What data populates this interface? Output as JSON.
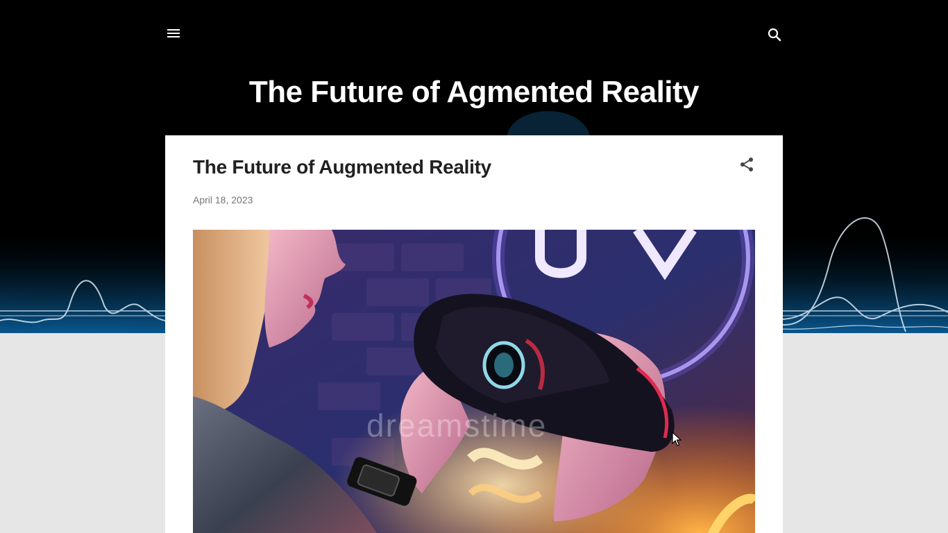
{
  "header": {
    "blog_title": "The Future of Agmented Reality",
    "menu_icon": "hamburger-menu-icon",
    "search_icon": "search-icon"
  },
  "post": {
    "title": "The Future of Augmented Reality",
    "date": "April 18, 2023",
    "share_icon": "share-icon",
    "image": {
      "description_icon": "vr-headset-photo",
      "watermark": "dreamstime"
    }
  },
  "colors": {
    "header_bg": "#000000",
    "page_bg": "#e6e6e6",
    "card_bg": "#ffffff",
    "title_text": "#212121",
    "date_text": "#757575",
    "wave_glow": "#1a8fd6"
  }
}
